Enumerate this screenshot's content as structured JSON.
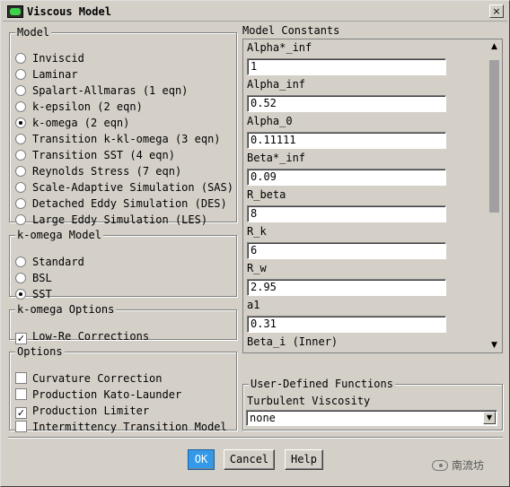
{
  "window": {
    "title": "Viscous Model",
    "close_glyph": "×"
  },
  "model": {
    "legend": "Model",
    "options": [
      {
        "label": "Inviscid",
        "selected": false
      },
      {
        "label": "Laminar",
        "selected": false
      },
      {
        "label": "Spalart-Allmaras (1 eqn)",
        "selected": false
      },
      {
        "label": "k-epsilon (2 eqn)",
        "selected": false
      },
      {
        "label": "k-omega (2 eqn)",
        "selected": true
      },
      {
        "label": "Transition k-kl-omega (3 eqn)",
        "selected": false
      },
      {
        "label": "Transition SST (4 eqn)",
        "selected": false
      },
      {
        "label": "Reynolds Stress (7 eqn)",
        "selected": false
      },
      {
        "label": "Scale-Adaptive Simulation (SAS)",
        "selected": false
      },
      {
        "label": "Detached Eddy Simulation (DES)",
        "selected": false
      },
      {
        "label": "Large Eddy Simulation (LES)",
        "selected": false
      }
    ]
  },
  "komega_model": {
    "legend": "k-omega Model",
    "options": [
      {
        "label": "Standard",
        "selected": false
      },
      {
        "label": "BSL",
        "selected": false
      },
      {
        "label": "SST",
        "selected": true
      }
    ]
  },
  "komega_options": {
    "legend": "k-omega Options",
    "items": [
      {
        "label": "Low-Re Corrections",
        "checked": true
      }
    ]
  },
  "options": {
    "legend": "Options",
    "items": [
      {
        "label": "Curvature Correction",
        "checked": false
      },
      {
        "label": "Production Kato-Launder",
        "checked": false
      },
      {
        "label": "Production Limiter",
        "checked": true
      },
      {
        "label": "Intermittency Transition Model",
        "checked": false
      }
    ]
  },
  "constants": {
    "heading": "Model Constants",
    "items": [
      {
        "label": "Alpha*_inf",
        "value": "1"
      },
      {
        "label": "Alpha_inf",
        "value": "0.52"
      },
      {
        "label": "Alpha_0",
        "value": "0.11111"
      },
      {
        "label": "Beta*_inf",
        "value": "0.09"
      },
      {
        "label": "R_beta",
        "value": "8"
      },
      {
        "label": "R_k",
        "value": "6"
      },
      {
        "label": "R_w",
        "value": "2.95"
      },
      {
        "label": "a1",
        "value": "0.31"
      },
      {
        "label": "Beta_i (Inner)",
        "value": ""
      }
    ],
    "scroll_up": "▲",
    "scroll_down": "▼"
  },
  "udf": {
    "legend": "User-Defined Functions",
    "turbulent_viscosity_label": "Turbulent Viscosity",
    "turbulent_viscosity_value": "none",
    "dropdown_glyph": "▼"
  },
  "buttons": {
    "ok": "OK",
    "cancel": "Cancel",
    "help": "Help"
  },
  "watermark": {
    "text": "南流坊"
  }
}
